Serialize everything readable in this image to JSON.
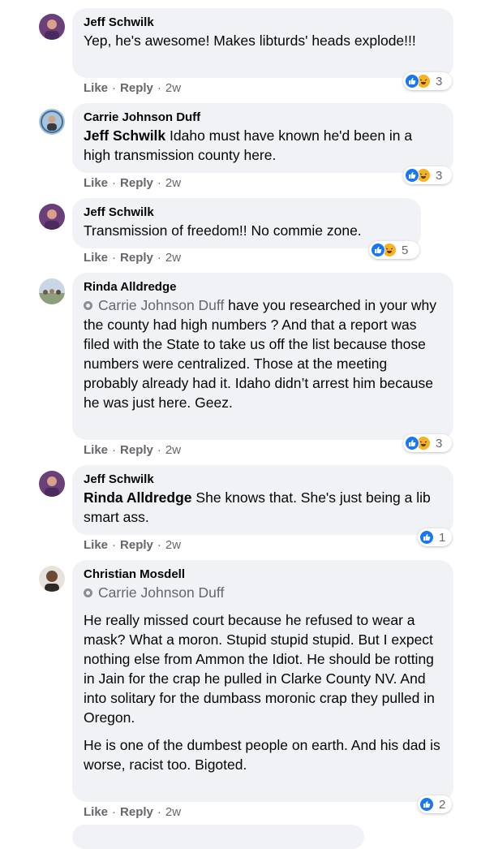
{
  "actions": {
    "like": "Like",
    "reply": "Reply",
    "separator": "·"
  },
  "colors": {
    "like_blue": "#1877f2",
    "haha_yellow": "#f7b125",
    "bubble_bg": "#f0f2f5",
    "secondary_text": "#65676b"
  },
  "comments": [
    {
      "author": "Jeff Schwilk",
      "text": "Yep, he's awesome! Makes libturds' heads explode!!!",
      "time": "2w",
      "reaction_count": "3",
      "reactions": [
        "like",
        "haha"
      ]
    },
    {
      "author": "Carrie Johnson Duff",
      "mention": "Jeff Schwilk",
      "text": " Idaho must have known he'd been in a high transmission county here.",
      "time": "2w",
      "reaction_count": "3",
      "reactions": [
        "like",
        "haha"
      ]
    },
    {
      "author": "Jeff Schwilk",
      "text": "Transmission of freedom!! No commie zone.",
      "time": "2w",
      "reaction_count": "5",
      "reactions": [
        "like",
        "haha"
      ]
    },
    {
      "author": "Rinda Alldredge",
      "tag": "Carrie Johnson Duff",
      "text": " have you researched in your why the county had high numbers ? And that a report was filed with the State to take us off the list because those numbers were centralized. Those at the meeting probably already had it. Idaho didn’t arrest him because he was just here. Geez.",
      "time": "2w",
      "reaction_count": "3",
      "reactions": [
        "like",
        "haha"
      ]
    },
    {
      "author": "Jeff Schwilk",
      "mention": "Rinda Alldredge",
      "text": " She knows that. She's just being a lib smart ass.",
      "time": "2w",
      "reaction_count": "1",
      "reactions": [
        "like"
      ]
    },
    {
      "author": "Christian Mosdell",
      "tag": "Carrie Johnson Duff",
      "paragraphs": [
        "He really missed court because he refused to wear a mask? What a moron. Stupid stupid stupid. But I expect nothing else from Ammon the Idiot. He should be rotting in Jain for the crap he pulled in Clarke County NV. And into solitary for the dumbass moronic crap they pulled in Oregon.",
        "He is one of the dumbest people on earth. And his dad is worse, racist too. Bigoted."
      ],
      "time": "2w",
      "reaction_count": "2",
      "reactions": [
        "like"
      ]
    }
  ]
}
